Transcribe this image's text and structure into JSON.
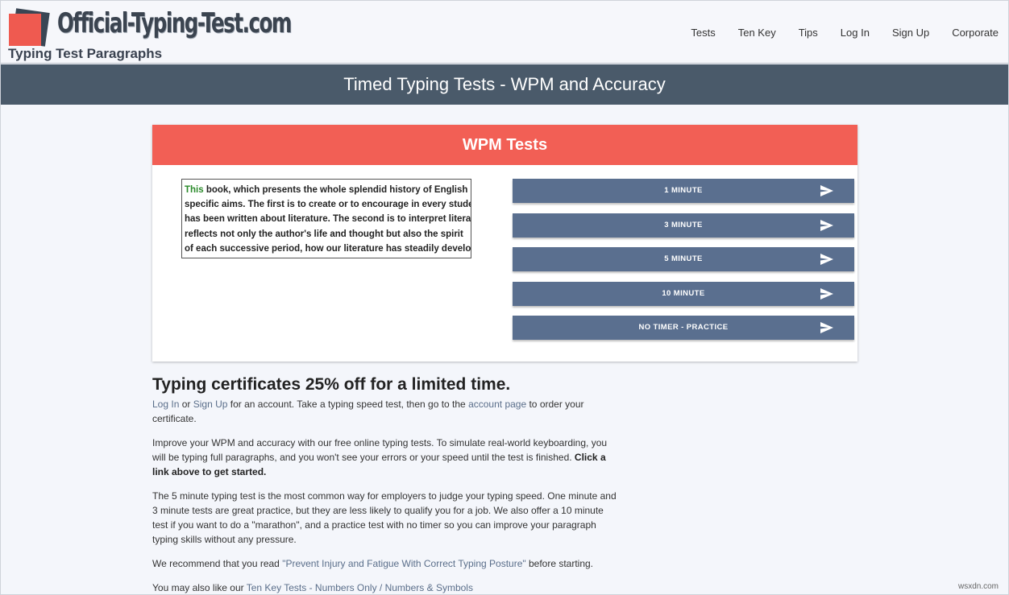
{
  "header": {
    "logo_text": "Official-Typing-Test.com",
    "subtitle": "Typing Test Paragraphs",
    "nav": [
      "Tests",
      "Ten Key",
      "Tips",
      "Log In",
      "Sign Up",
      "Corporate"
    ]
  },
  "banner": {
    "title": "Timed Typing Tests - WPM and Accuracy"
  },
  "card": {
    "title": "WPM Tests",
    "sample": {
      "highlight": "This",
      "line1_rest": " book, which presents the whole splendid history of English",
      "line2": "specific aims. The first is to create or to encourage in every stude",
      "line3": "has been written about literature. The second is to interpret literat",
      "line4": "reflects not only the author's life and thought but also the spirit",
      "line5": "of each successive period, how our literature has steadily develop"
    },
    "buttons": [
      "1 MINUTE",
      "3 MINUTE",
      "5 MINUTE",
      "10 MINUTE",
      "NO TIMER - PRACTICE"
    ]
  },
  "content": {
    "promo_title": "Typing certificates 25% off for a limited time.",
    "p1": {
      "login": "Log In",
      "or": " or ",
      "signup": "Sign Up",
      "mid": " for an account. Take a typing speed test, then go to the ",
      "account": "account page",
      "end": " to order your certificate."
    },
    "p2_text": "Improve your WPM and accuracy with our free online typing tests. To simulate real-world keyboarding, you will be typing full paragraphs, and you won't see your errors or your speed until the test is finished.",
    "p2_bold": "Click a link above to get started.",
    "p3": "The 5 minute typing test is the most common way for employers to judge your typing speed. One minute and 3 minute tests are great practice, but they are less likely to qualify you for a job. We also offer a 10 minute test if you want to do a \"marathon\", and a practice test with no timer so you can improve your paragraph typing skills without any pressure.",
    "p4": {
      "pre": "We recommend that you read ",
      "link": "\"Prevent Injury and Fatigue With Correct Typing Posture\"",
      "post": " before starting."
    },
    "p5": {
      "pre": "You may also like our ",
      "link": "Ten Key Tests - Numbers Only / Numbers & Symbols"
    }
  },
  "watermark": "wsxdn.com",
  "colors": {
    "accent_red": "#f25f55",
    "banner": "#4a5a6a",
    "button": "#5a6f8f",
    "link": "#5a6e8a"
  }
}
